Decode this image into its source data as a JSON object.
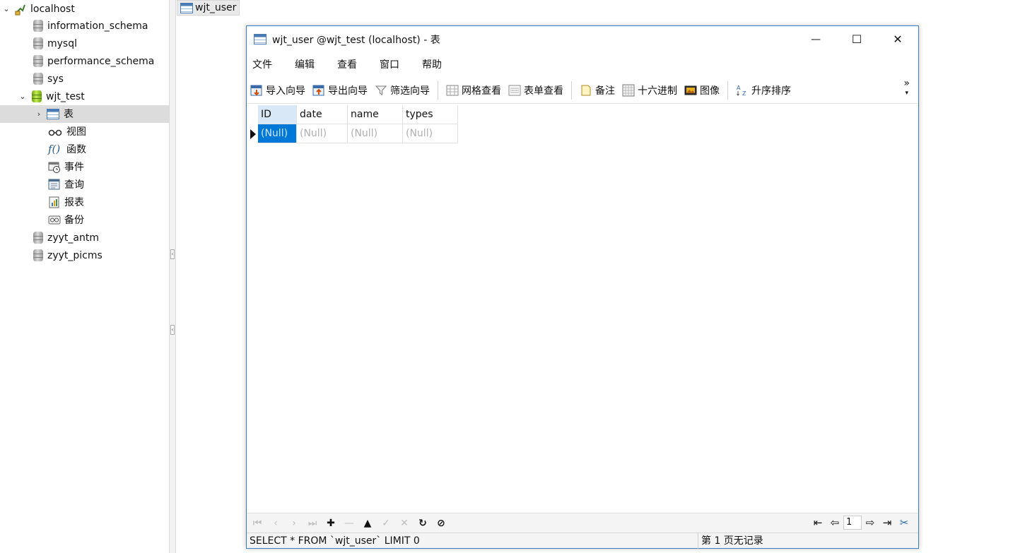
{
  "tree": {
    "connection": "localhost",
    "databases": [
      "information_schema",
      "mysql",
      "performance_schema",
      "sys",
      "wjt_test",
      "zyyt_antm",
      "zyyt_picms"
    ],
    "open_db": "wjt_test",
    "children": [
      "表",
      "视图",
      "函数",
      "事件",
      "查询",
      "报表",
      "备份"
    ]
  },
  "object_tab": {
    "label": "wjt_user"
  },
  "window": {
    "title": "wjt_user @wjt_test (localhost) - 表",
    "buttons": {
      "minimize": "—",
      "maximize": "☐",
      "close": "✕"
    }
  },
  "menu": [
    "文件",
    "编辑",
    "查看",
    "窗口",
    "帮助"
  ],
  "toolbar": {
    "import": "导入向导",
    "export": "导出向导",
    "filter": "筛选向导",
    "grid_view": "网格查看",
    "form_view": "表单查看",
    "memo": "备注",
    "hex": "十六进制",
    "image": "图像",
    "sort": "升序排序",
    "overflow": "»"
  },
  "grid": {
    "columns": [
      "ID",
      "date",
      "name",
      "types"
    ],
    "rows": [
      [
        "(Null)",
        "(Null)",
        "(Null)",
        "(Null)"
      ]
    ]
  },
  "pager": {
    "page": "1"
  },
  "status": {
    "sql": "SELECT * FROM `wjt_user` LIMIT 0",
    "info": "第 1 页无记录"
  }
}
